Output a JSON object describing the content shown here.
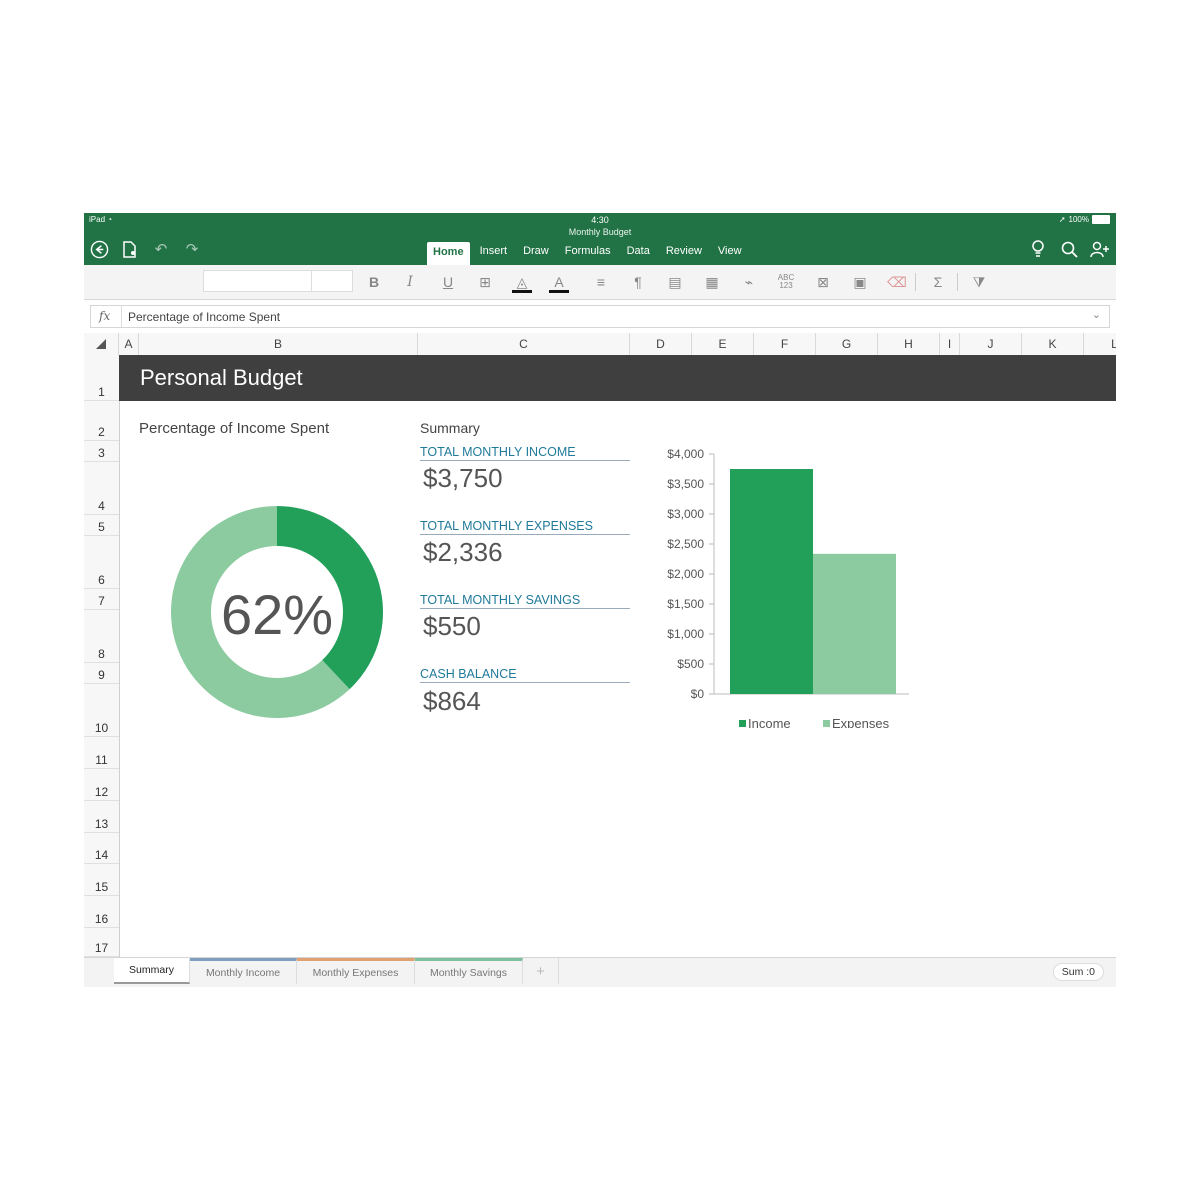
{
  "status": {
    "device": "iPad",
    "time": "4:30",
    "battery": "100%"
  },
  "doc_title": "Monthly Budget",
  "ribbon_tabs": [
    {
      "label": "Home",
      "active": true
    },
    {
      "label": "Insert"
    },
    {
      "label": "Draw"
    },
    {
      "label": "Formulas"
    },
    {
      "label": "Data"
    },
    {
      "label": "Review"
    },
    {
      "label": "View"
    }
  ],
  "ribbon": {
    "bold": "B",
    "italic": "I",
    "underline": "U",
    "spelling": "ABC\n123",
    "sum": "Σ"
  },
  "formula_bar": {
    "fx": "fx",
    "content": "Percentage of Income Spent"
  },
  "columns": [
    "A",
    "B",
    "C",
    "D",
    "E",
    "F",
    "G",
    "H",
    "I",
    "J",
    "K",
    "L"
  ],
  "rows": [
    "1",
    "2",
    "3",
    "4",
    "5",
    "6",
    "7",
    "8",
    "9",
    "10",
    "11",
    "12",
    "13",
    "14",
    "15",
    "16",
    "17"
  ],
  "sheet_title": "Personal Budget",
  "donut": {
    "label": "Percentage of Income Spent",
    "percent_text": "62%",
    "fraction": 0.62,
    "spent_color": "#8ccba0",
    "remaining_color": "#22a05a"
  },
  "summary": {
    "heading": "Summary",
    "items": [
      {
        "label": "TOTAL MONTHLY INCOME",
        "value": "$3,750"
      },
      {
        "label": "TOTAL MONTHLY EXPENSES",
        "value": "$2,336"
      },
      {
        "label": "TOTAL MONTHLY SAVINGS",
        "value": "$550"
      },
      {
        "label": "CASH BALANCE",
        "value": "$864"
      }
    ]
  },
  "chart_data": {
    "type": "bar",
    "series": [
      {
        "name": "Income",
        "values": [
          3750
        ],
        "color": "#22a05a"
      },
      {
        "name": "Expenses",
        "values": [
          2336
        ],
        "color": "#8ccba0"
      }
    ],
    "ylim": [
      0,
      4000
    ],
    "yticks": [
      "$4,000",
      "$3,500",
      "$3,000",
      "$2,500",
      "$2,000",
      "$1,500",
      "$1,000",
      "$500",
      "$0"
    ],
    "ytick_values": [
      4000,
      3500,
      3000,
      2500,
      2000,
      1500,
      1000,
      500,
      0
    ],
    "legend_position": "bottom",
    "grid": false
  },
  "sheet_tabs": [
    {
      "label": "Summary",
      "active": true
    },
    {
      "label": "Monthly Income",
      "color": "#7f9fc0"
    },
    {
      "label": "Monthly Expenses",
      "color": "#e0a070"
    },
    {
      "label": "Monthly Savings",
      "color": "#7cc0a0"
    },
    {
      "label": "+"
    }
  ],
  "status_sum": "Sum :0",
  "colors": {
    "app_green": "#217346",
    "title_band": "#3f3f3f",
    "kpi_label": "#1f7a9a"
  }
}
